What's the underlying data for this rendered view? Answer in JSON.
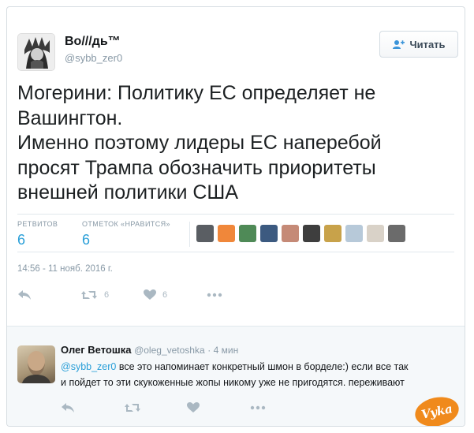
{
  "author": {
    "name": "Во///дь™",
    "handle": "@sybb_zer0",
    "follow_label": "Читать"
  },
  "tweet": {
    "lines": [
      "Могерини: Политику ЕС определяет не",
      "Вашингтон.",
      "Именно поэтому лидеры ЕС наперебой",
      "просят Трампа обозначить приоритеты",
      "внешней политики США"
    ],
    "stats": {
      "retweets_label": "РЕТВИТОВ",
      "retweets_value": "6",
      "likes_label": "ОТМЕТОК «НРАВИТСЯ»",
      "likes_value": "6"
    },
    "liker_colors": [
      "#5a5e63",
      "#f0873a",
      "#4f8a57",
      "#3c5a80",
      "#c58a77",
      "#3e3e3e",
      "#c8a24a",
      "#b7c9d9",
      "#d9d2c8",
      "#6b6b6b"
    ],
    "timestamp": "14:56 - 11 нояб. 2016 г.",
    "actions": {
      "retweet_count": "6",
      "like_count": "6"
    }
  },
  "reply": {
    "name": "Олег Ветошка",
    "handle": "@oleg_vetoshka",
    "time": "· 4 мин",
    "mention": "@sybb_zer0",
    "line1_rest": " все это напоминает конкретный шмон в борделе:) если все так",
    "line2": "и пойдет то эти скукоженные жопы никому уже не пригодятся. переживают"
  },
  "watermark": "Vyka",
  "colors": {
    "accent": "#2a9fd8",
    "muted": "#8899a6",
    "icon": "#aab8c2"
  }
}
